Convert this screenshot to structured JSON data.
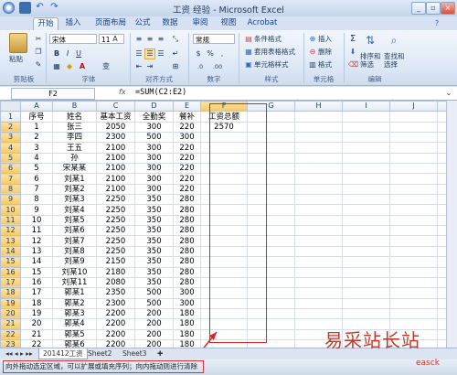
{
  "window": {
    "title": "工资 经验 - Microsoft Excel"
  },
  "tabs": [
    "开始",
    "插入",
    "页面布局",
    "公式",
    "数据",
    "审阅",
    "视图",
    "Acrobat"
  ],
  "ribbon": {
    "clipboard": {
      "paste": "粘贴",
      "label": "剪贴板"
    },
    "font": {
      "name": "宋体",
      "size": "11",
      "label": "字体",
      "b": "B",
      "i": "I",
      "u": "U",
      "a": "A",
      "wen": "变"
    },
    "align": {
      "label": "对齐方式"
    },
    "number": {
      "format": "常规",
      "label": "数字",
      "percent": "%",
      "comma": ",",
      "inc": ".0",
      "dec": ".00",
      "currency": "$"
    },
    "styles": {
      "cond": "条件格式",
      "table": "套用表格格式",
      "cell": "单元格样式",
      "label": "样式"
    },
    "cells": {
      "insert": "插入",
      "delete": "删除",
      "format": "格式",
      "label": "单元格"
    },
    "edit": {
      "sum": "Σ",
      "sort": "排序和\n筛选",
      "find": "查找和\n选择",
      "label": "编辑"
    }
  },
  "formula_bar": {
    "namebox": "F2",
    "fx": "fx",
    "formula": "=SUM(C2:E2)"
  },
  "columns": [
    "A",
    "B",
    "C",
    "D",
    "E",
    "F",
    "G",
    "H",
    "I",
    "J",
    "K"
  ],
  "header_row": [
    "序号",
    "姓名",
    "基本工资",
    "全勤奖",
    "餐补",
    "工资总额"
  ],
  "rows": [
    [
      "1",
      "张三",
      "2050",
      "300",
      "220",
      "2570"
    ],
    [
      "2",
      "李四",
      "2300",
      "500",
      "300",
      ""
    ],
    [
      "3",
      "王五",
      "2100",
      "300",
      "220",
      ""
    ],
    [
      "4",
      "孙",
      "2100",
      "300",
      "220",
      ""
    ],
    [
      "5",
      "宋某某",
      "2100",
      "300",
      "220",
      ""
    ],
    [
      "6",
      "刘某1",
      "2100",
      "300",
      "220",
      ""
    ],
    [
      "7",
      "刘某2",
      "2100",
      "300",
      "220",
      ""
    ],
    [
      "8",
      "刘某3",
      "2250",
      "350",
      "280",
      ""
    ],
    [
      "9",
      "刘某4",
      "2250",
      "350",
      "280",
      ""
    ],
    [
      "10",
      "刘某5",
      "2250",
      "350",
      "280",
      ""
    ],
    [
      "11",
      "刘某6",
      "2250",
      "350",
      "280",
      ""
    ],
    [
      "12",
      "刘某7",
      "2250",
      "350",
      "280",
      ""
    ],
    [
      "13",
      "刘某8",
      "2250",
      "350",
      "280",
      ""
    ],
    [
      "14",
      "刘某9",
      "2150",
      "350",
      "280",
      ""
    ],
    [
      "15",
      "刘某10",
      "2180",
      "350",
      "280",
      ""
    ],
    [
      "16",
      "刘某11",
      "2080",
      "350",
      "280",
      ""
    ],
    [
      "17",
      "郭某1",
      "2350",
      "500",
      "300",
      ""
    ],
    [
      "18",
      "郭某2",
      "2300",
      "500",
      "300",
      ""
    ],
    [
      "19",
      "郭某3",
      "2200",
      "200",
      "180",
      ""
    ],
    [
      "20",
      "郭某4",
      "2200",
      "200",
      "180",
      ""
    ],
    [
      "21",
      "郭某5",
      "2200",
      "200",
      "180",
      ""
    ],
    [
      "22",
      "郭某6",
      "2200",
      "200",
      "180",
      ""
    ],
    [
      "23",
      "郭某7",
      "2200",
      "200",
      "180",
      ""
    ]
  ],
  "sheets": [
    "201412工资",
    "Sheet2",
    "Sheet3"
  ],
  "status": {
    "message": "向外拖动选定区域，可以扩展或填充序列；向内拖动则进行清除"
  },
  "watermark": {
    "main": "易采站长站",
    "sub": "easck"
  },
  "colors": {
    "selection_border": "#000000",
    "annotation": "#dd2222"
  }
}
